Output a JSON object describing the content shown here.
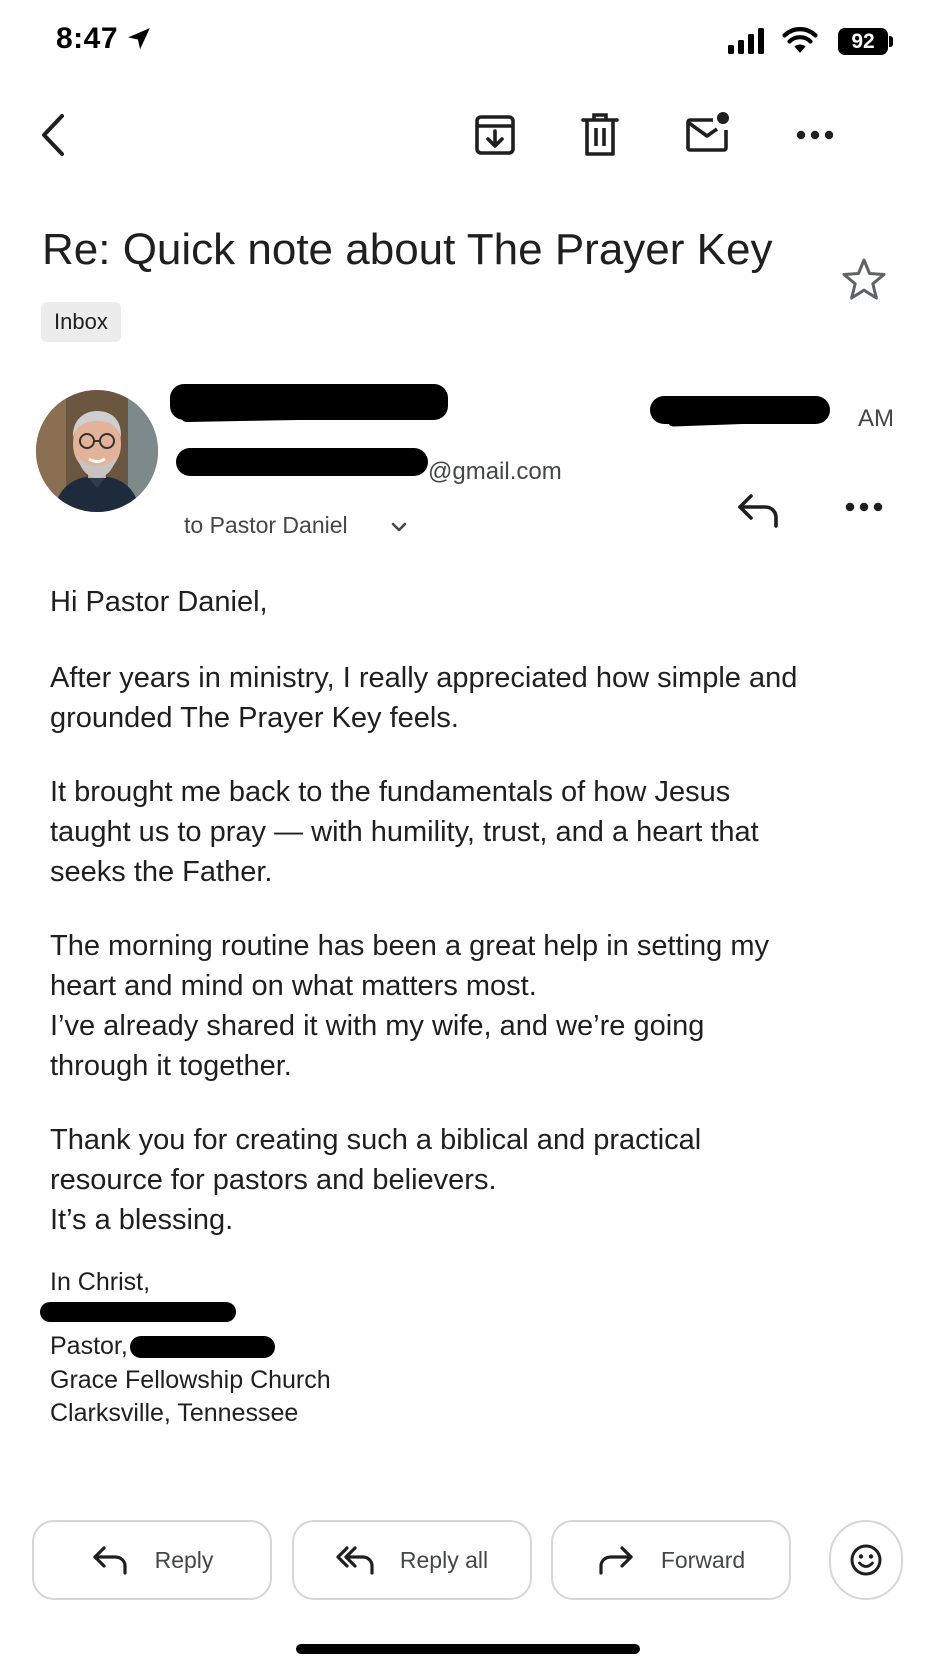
{
  "status_bar": {
    "time": "8:47",
    "battery": "92",
    "icons": [
      "location-arrow-icon",
      "cellular-signal-icon",
      "wifi-icon",
      "battery-icon"
    ]
  },
  "toolbar": {
    "icons": [
      "back-arrow-icon",
      "archive-icon",
      "trash-icon",
      "mark-unread-icon",
      "more-horizontal-icon"
    ]
  },
  "email": {
    "subject": "Re: Quick note about The Prayer Key",
    "label": "Inbox",
    "sender": {
      "email_visible_suffix": "@gmail.com",
      "time_visible_suffix": "AM",
      "recipients_line": "to Pastor Daniel"
    },
    "body": {
      "paragraphs": [
        "Hi Pastor Daniel,",
        "After years in ministry, I really appreciated how simple and grounded The Prayer Key feels.",
        "It brought me back to the fundamentals of how Jesus taught us to pray — with humility, trust, and a heart that seeks the Father.",
        "The morning routine has been a great help in setting my heart and mind on what matters most.\nI’ve already shared it with my wife, and we’re going through it together.",
        "Thank you for creating such a biblical and practical resource for pastors and believers.\nIt’s a blessing."
      ]
    },
    "signature": {
      "closing": "In Christ,",
      "title_prefix": "Pastor,",
      "church": "Grace Fellowship Church",
      "location": "Clarksville, Tennessee"
    }
  },
  "actions": {
    "reply": "Reply",
    "reply_all": "Reply all",
    "forward": "Forward"
  },
  "colors": {
    "text_primary": "#1f1f1f",
    "text_secondary": "#444746",
    "chip_bg": "#ececec",
    "button_border": "#d3d6db"
  }
}
